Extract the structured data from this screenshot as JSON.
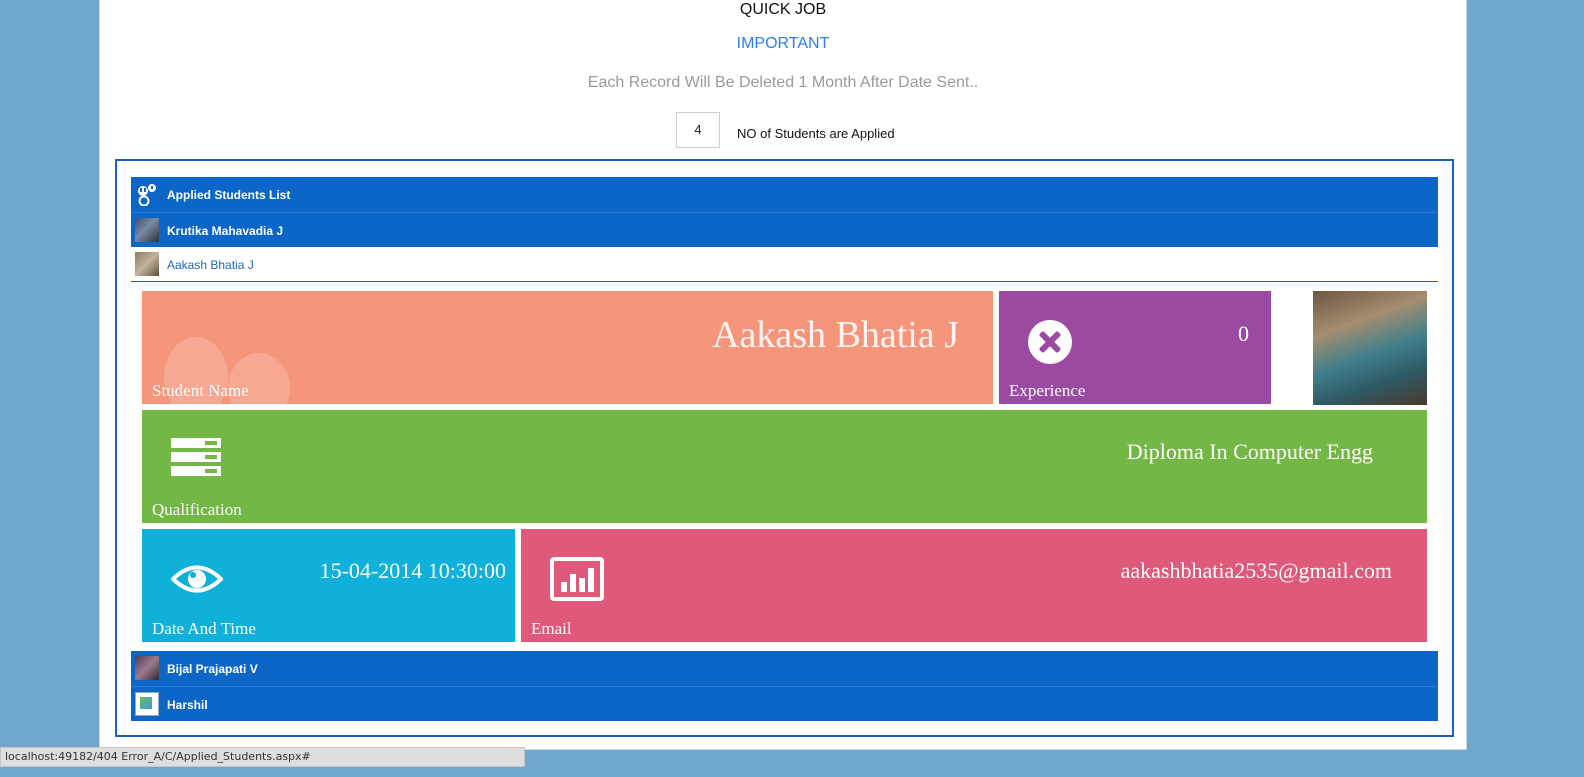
{
  "header": {
    "title": "QUICK JOB",
    "important": "IMPORTANT",
    "notice": "Each Record Will Be Deleted 1 Month After Date Sent.."
  },
  "applied": {
    "count": "4",
    "label": "NO of Students are Applied"
  },
  "list": {
    "title": "Applied Students List",
    "students": [
      {
        "name": "Krutika Mahavadia J",
        "expanded": false
      },
      {
        "name": "Aakash Bhatia J",
        "expanded": true
      },
      {
        "name": "Bijal Prajapati V",
        "expanded": false
      },
      {
        "name": "Harshil",
        "expanded": false
      }
    ]
  },
  "detail": {
    "student_name": {
      "label": "Student Name",
      "value": "Aakash Bhatia J"
    },
    "experience": {
      "label": "Experience",
      "value": "0"
    },
    "qualification": {
      "label": "Qualification",
      "value": "Diploma In Computer Engg"
    },
    "date_time": {
      "label": "Date And Time",
      "value": "15-04-2014 10:30:00"
    },
    "email": {
      "label": "Email",
      "value": "aakashbhatia2535@gmail.com"
    }
  },
  "status_bar": {
    "url": "localhost:49182/404 Error_A/C/Applied_Students.aspx#"
  },
  "icons": {
    "list_header": "users-icon",
    "experience": "close-circle-icon",
    "qualification": "server-icon",
    "date_time": "eye-icon",
    "email": "bar-chart-icon"
  },
  "colors": {
    "background": "#6fa7cf",
    "list_bar": "#0c66c7",
    "tile_name": "#f5957a",
    "tile_experience": "#9b4aa1",
    "tile_qualification": "#73b746",
    "tile_date": "#0fb0d9",
    "tile_email": "#df597a",
    "important_text": "#2f7ee6"
  }
}
